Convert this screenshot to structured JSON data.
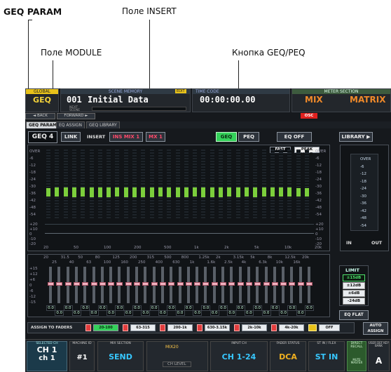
{
  "callouts": {
    "geq_param": "GEQ PARAM",
    "insert_field": "Поле INSERT",
    "module_field": "Поле MODULE",
    "geq_peq_button": "Кнопка GEQ/PEQ"
  },
  "topbar": {
    "global": "GLOBAL",
    "geq": "GEQ",
    "back": "◄ BACK",
    "forward": "FORWARD ►",
    "scene_memory_label": "SCENE MEMORY",
    "scene_number": "001",
    "scene_title": "Initial Data",
    "edit": "EDIT",
    "next_scene": "NEXT SCENE",
    "timecode_label": "TIME CODE",
    "timecode": "00:00:00.00",
    "meter_label": "METER SECTION",
    "mix": "MIX",
    "matrix": "MATRIX",
    "osc": "OSC"
  },
  "tabs": [
    "GEQ PARAM",
    "EQ ASSIGN",
    "GEQ LIBRARY"
  ],
  "geq_bar": {
    "module": "GEQ 4",
    "link": "LINK",
    "insert_label": "INSERT",
    "insert_value": "INS MIX 1",
    "insert_value2": "MX 1",
    "geq": "GEQ",
    "peq": "PEQ",
    "eq_off": "EQ OFF",
    "library": "LIBRARY ▶"
  },
  "meter_opts": {
    "fast": "FAST",
    "peak_hold": "PEAK HOLD"
  },
  "meter_scale": [
    "OVER",
    "-6",
    "-12",
    "-18",
    "-24",
    "-30",
    "-36",
    "-42",
    "-48",
    "-54"
  ],
  "curve_scale": [
    "+20",
    "+10",
    "0",
    "-10",
    "-20"
  ],
  "freq_axis": [
    "20",
    "50",
    "100",
    "200",
    "500",
    "1k",
    "2k",
    "5k",
    "10k",
    "20k"
  ],
  "band_freqs_top": [
    "20",
    "31.5",
    "50",
    "80",
    "125",
    "200",
    "315",
    "500",
    "800",
    "1.25k",
    "2k",
    "3.15k",
    "5k",
    "8k",
    "12.5k",
    "20k"
  ],
  "band_freqs_bottom": [
    "25",
    "40",
    "63",
    "100",
    "160",
    "250",
    "400",
    "630",
    "1k",
    "1.6k",
    "2.5k",
    "4k",
    "6.3k",
    "10k",
    "16k"
  ],
  "fader_scale": [
    "+15",
    "+12",
    "+6",
    "0",
    "-6",
    "-12",
    "-15"
  ],
  "band_levels": [
    0.42,
    0.44,
    0.45,
    0.46,
    0.45,
    0.46,
    0.47,
    0.46,
    0.45,
    0.46,
    0.47,
    0.46,
    0.46,
    0.45,
    0.46,
    0.47,
    0.46,
    0.45,
    0.46,
    0.47,
    0.46,
    0.45,
    0.46,
    0.45,
    0.46,
    0.45,
    0.44,
    0.45,
    0.43,
    0.42,
    0.4
  ],
  "band_value": "0.0",
  "io_meter": {
    "in": "IN",
    "out": "OUT"
  },
  "limit": {
    "title": "LIMIT",
    "options": [
      "±15dB",
      "±12dB",
      "±6dB",
      "-24dB"
    ],
    "selected": 0
  },
  "eq_flat": "EQ FLAT",
  "assign": {
    "label": "ASSIGN TO FADERS",
    "groups": [
      "20-100",
      "63-315",
      "200-1k",
      "630-3.15k",
      "2k-10k",
      "4k-20k"
    ],
    "off": "OFF",
    "auto": "AUTO ASSIGN"
  },
  "bottom": {
    "selected_ch_label": "SELECTED CH",
    "ch1": "CH 1",
    "ch1b": "ch 1",
    "machine_id": "MACHINE ID",
    "machine_num": "#1",
    "mix_section": "MIX SECTION",
    "send": "SEND",
    "mix20": "MIX20",
    "ch_level": "CH LEVEL",
    "input_ch": "INPUT CH",
    "ch_range": "CH 1-24",
    "fader_status": "FADER STATUS",
    "dca": "DCA",
    "st_label": "ST IN / FLEX",
    "st_in": "ST IN",
    "direct_recall": "DIRECT RECALL",
    "user_key": "USER DEF KEY BANK",
    "mute_master": "MUTE MASTER",
    "bank": "A"
  }
}
